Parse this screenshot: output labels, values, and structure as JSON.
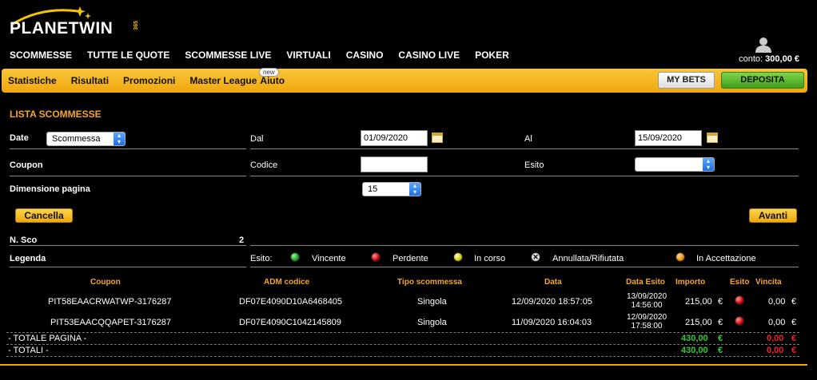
{
  "brand": {
    "name": "PLANETWIN",
    "sup": "365"
  },
  "topnav": [
    "SCOMMESSE",
    "TUTTE LE QUOTE",
    "SCOMMESSE LIVE",
    "VIRTUALI",
    "CASINO",
    "CASINO LIVE",
    "POKER"
  ],
  "account": {
    "conto_label": "conto:",
    "conto_value": "300,00 €"
  },
  "subnav": [
    "Statistiche",
    "Risultati",
    "Promozioni",
    "Master League",
    "Aiuto"
  ],
  "badge_new": "new",
  "buttons": {
    "mybets": "MY BETS",
    "deposita": "DEPOSITA",
    "cancella": "Cancella",
    "avanti": "Avanti"
  },
  "section_title": "LISTA SCOMMESSE",
  "filters": {
    "date_label": "Date",
    "date_type": "Scommessa",
    "dal_label": "Dal",
    "dal_value": "01/09/2020",
    "al_label": "Al",
    "al_value": "15/09/2020",
    "coupon_label": "Coupon",
    "codice_label": "Codice",
    "codice_value": "",
    "esito_label": "Esito",
    "esito_value": "",
    "page_size_label": "Dimensione pagina",
    "page_size_value": "15"
  },
  "summary": {
    "nsco_label": "N. Sco",
    "nsco_value": "2"
  },
  "legend": {
    "label": "Legenda",
    "esito_label": "Esito:",
    "items": [
      "Vincente",
      "Perdente",
      "In corso",
      "Annullata/Rifiutata",
      "In Accettazione"
    ]
  },
  "table": {
    "headers": [
      "Coupon",
      "ADM codice",
      "Tipo scommessa",
      "Data",
      "Data Esito",
      "Importo",
      "Esito",
      "Vincita"
    ],
    "rows": [
      {
        "coupon": "PIT58EAACRWATWP-3176287",
        "adm": "DF07E4090D10A6468405",
        "tipo": "Singola",
        "data": "12/09/2020 18:57:05",
        "esito_date": "13/09/2020",
        "esito_time": "14:56:00",
        "importo": "215,00",
        "currency": "€",
        "esito_status": "Perdente",
        "vincita": "0,00"
      },
      {
        "coupon": "PIT53EAACQQAPET-3176287",
        "adm": "DF07E4090C1042145809",
        "tipo": "Singola",
        "data": "11/09/2020 16:04:03",
        "esito_date": "12/09/2020",
        "esito_time": "17:58:00",
        "importo": "215,00",
        "currency": "€",
        "esito_status": "Perdente",
        "vincita": "0,00"
      }
    ],
    "totale_pagina": {
      "label": "- TOTALE PAGINA -",
      "importo": "430,00",
      "vincita": "0,00"
    },
    "totali": {
      "label": "- TOTALI -",
      "importo": "430,00",
      "vincita": "0,00"
    }
  },
  "colors": {
    "accent": "#f5a623",
    "yellow_bar": "#f0a80c",
    "green": "#33cc33",
    "red": "#ee2222"
  }
}
